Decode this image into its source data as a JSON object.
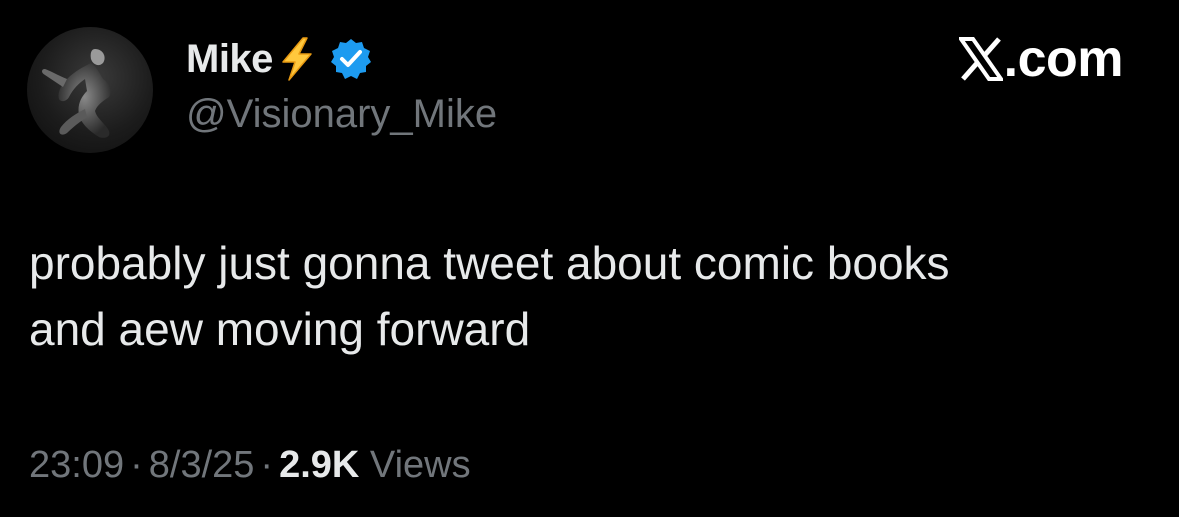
{
  "tweet": {
    "author": {
      "display_name": "Mike",
      "name_emoji": "lightning-bolt-icon",
      "verified": true,
      "handle": "@Visionary_Mike",
      "avatar": "avatar"
    },
    "brand": {
      "logo_icon": "x-logo-icon",
      "suffix": ".com"
    },
    "text": "probably just gonna tweet about comic books\nand aew moving forward",
    "meta": {
      "time": "23:09",
      "separator": "·",
      "date": "8/3/25",
      "views_count": "2.9K",
      "views_label": "Views"
    }
  },
  "colors": {
    "background": "#000000",
    "primary_text": "#e7e9ea",
    "secondary_text": "#71767b",
    "verified_badge": "#1d9bf0",
    "bolt": "#ffc83d"
  }
}
